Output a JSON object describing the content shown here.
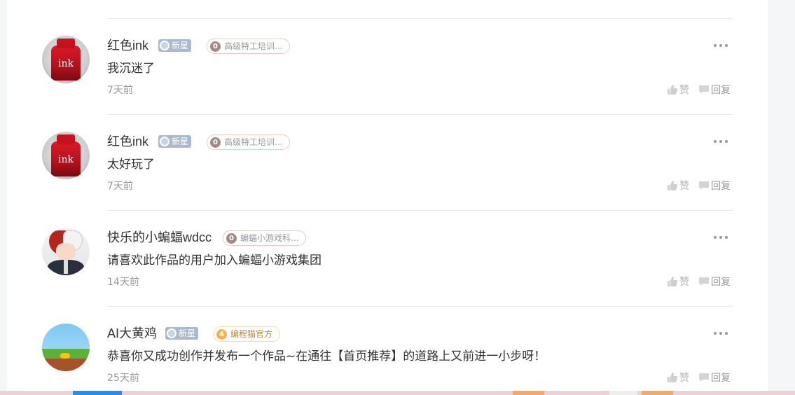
{
  "comments": [
    {
      "username": "红色ink",
      "badge": "新星",
      "team_level": "0",
      "team_name": "高级特工培训...",
      "content": "我沉迷了",
      "time": "7天前",
      "like_label": "赞",
      "reply_label": "回复",
      "avatar": "ink-bottle",
      "avatar_text": "ink"
    },
    {
      "username": "红色ink",
      "badge": "新星",
      "team_level": "0",
      "team_name": "高级特工培训...",
      "content": "太好玩了",
      "time": "7天前",
      "like_label": "赞",
      "reply_label": "回复",
      "avatar": "ink-bottle",
      "avatar_text": "ink"
    },
    {
      "username": "快乐的小蝙蝠wdcc",
      "team_level": "0",
      "team_name": "蝙蝠小游戏科...",
      "content": "请喜欢此作品的用户加入蝙蝠小游戏集团",
      "time": "14天前",
      "like_label": "赞",
      "reply_label": "回复",
      "avatar": "anime-character"
    },
    {
      "username": "AI大黄鸡",
      "badge": "新星",
      "team_level": "4",
      "team_name": "编程猫官方",
      "content": "恭喜你又成功创作并发布一个作品~在通往【首页推荐】的道路上又前进一小步呀！",
      "time": "25天前",
      "like_label": "赞",
      "reply_label": "回复",
      "avatar": "pixel-landscape"
    }
  ],
  "colors": {
    "text_primary": "#333333",
    "text_secondary": "#9a9a9a",
    "badge_newstar": "#a9b9cf",
    "accent_blue": "#2b8ce8",
    "accent_orange": "#f3a96a"
  }
}
